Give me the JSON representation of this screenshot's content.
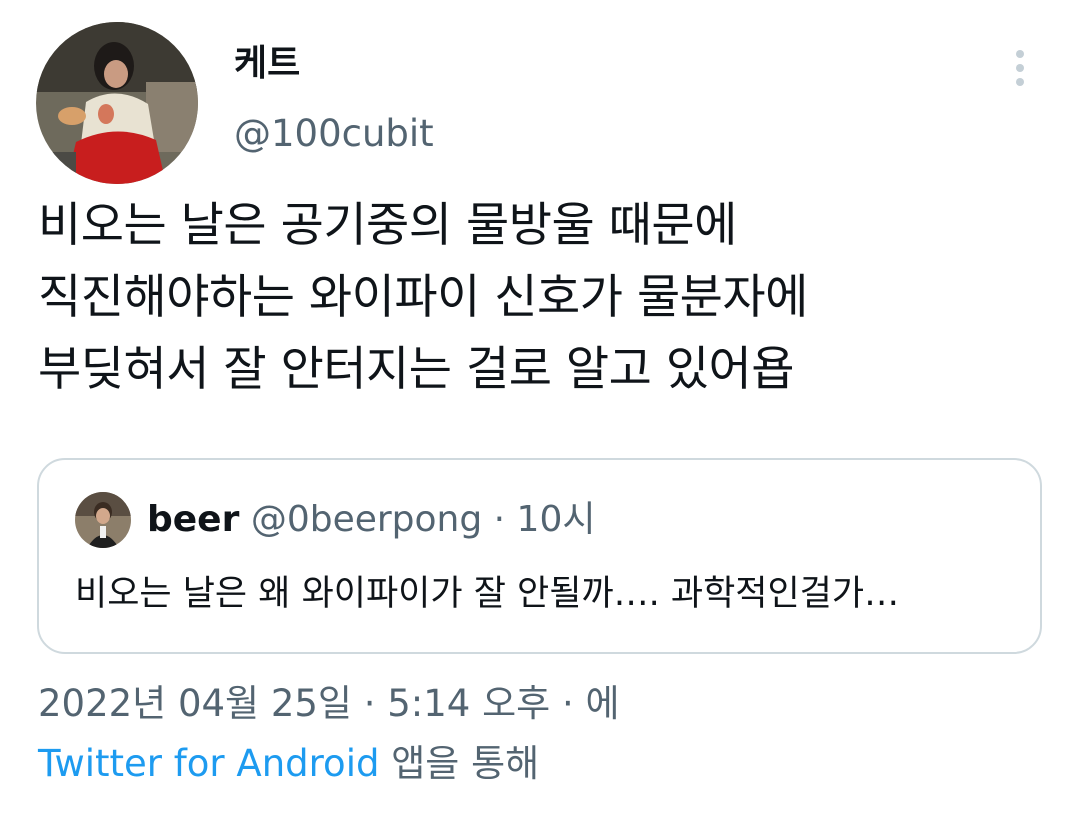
{
  "author": {
    "display_name": "케트",
    "handle": "@100cubit"
  },
  "tweet": {
    "lines": [
      "비오는 날은 공기중의 물방울 때문에",
      "직진해야하는 와이파이 신호가 물분자에",
      "부딪혀서 잘 안터지는 걸로 알고 있어욥"
    ]
  },
  "quote": {
    "name": "beer",
    "meta": "@0beerpong · 10시",
    "text": "비오는 날은 왜 와이파이가 잘 안될까…. 과학적인걸가…"
  },
  "timestamp": "2022년 04월 25일 · 5:14 오후 · 에",
  "source": {
    "app": "Twitter for Android",
    "suffix": "앱을 통해"
  },
  "icons": {
    "more": "more-vertical-icon"
  },
  "colors": {
    "text_primary": "#0f1419",
    "text_secondary": "#536471",
    "link": "#1d9bf0",
    "border": "#cfd9de"
  }
}
